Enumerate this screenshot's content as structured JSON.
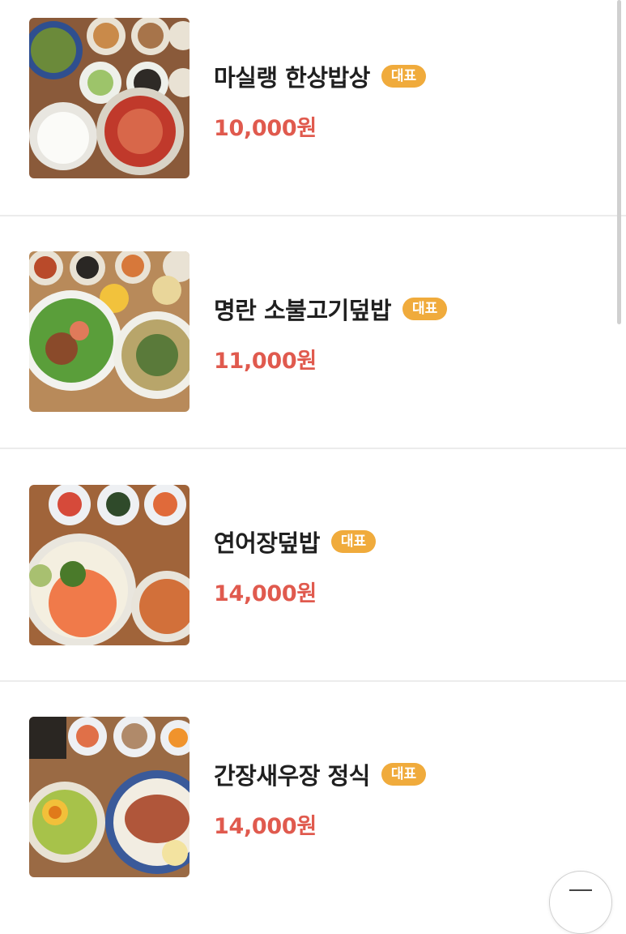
{
  "menu": {
    "items": [
      {
        "name": "마실랭 한상밥상",
        "badge": "대표",
        "price": "10,000원",
        "photo_icon": "korean-meal-set-photo",
        "accent_color": "#c0392b"
      },
      {
        "name": "명란 소불고기덮밥",
        "badge": "대표",
        "price": "11,000원",
        "photo_icon": "bulgogi-rice-bowl-photo",
        "accent_color": "#5a9e3a"
      },
      {
        "name": "연어장덮밥",
        "badge": "대표",
        "price": "14,000원",
        "photo_icon": "salmon-rice-bowl-photo",
        "accent_color": "#f07a4a"
      },
      {
        "name": "간장새우장 정식",
        "badge": "대표",
        "price": "14,000원",
        "photo_icon": "soy-shrimp-set-photo",
        "accent_color": "#b0563a"
      }
    ]
  },
  "colors": {
    "badge_bg": "#f0ab3c",
    "price": "#e05a4e",
    "name": "#1f1f1f",
    "divider": "#ececec"
  }
}
